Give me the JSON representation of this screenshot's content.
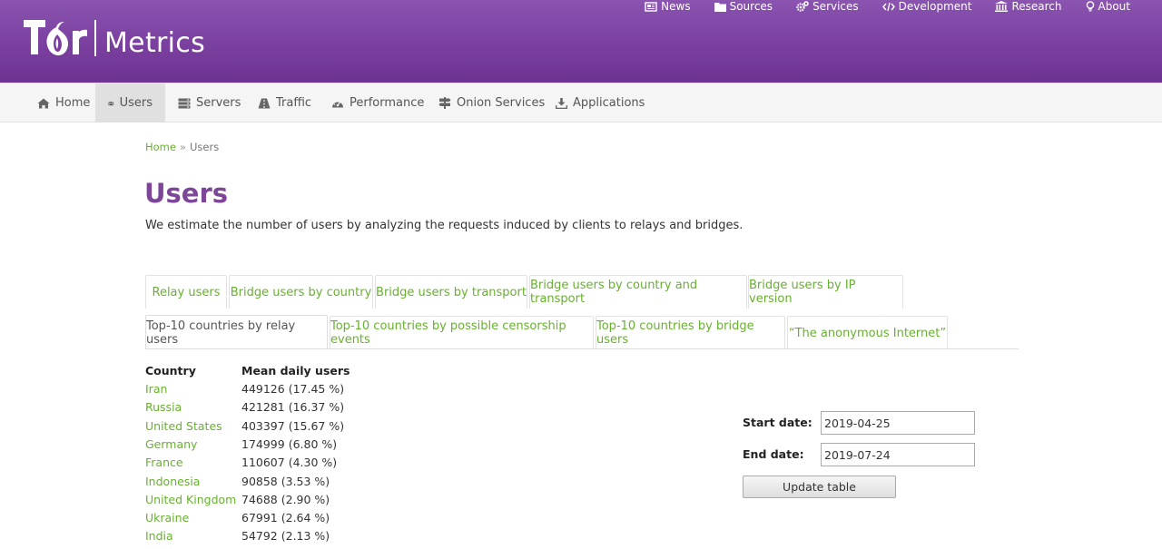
{
  "header": {
    "logo_text": "Tor",
    "product_name": "Metrics",
    "top_nav": [
      {
        "label": "News",
        "icon": "newspaper-icon"
      },
      {
        "label": "Sources",
        "icon": "folder-icon"
      },
      {
        "label": "Services",
        "icon": "cogs-icon"
      },
      {
        "label": "Development",
        "icon": "code-icon"
      },
      {
        "label": "Research",
        "icon": "institution-icon"
      },
      {
        "label": "About",
        "icon": "lightbulb-icon"
      }
    ]
  },
  "subnav": {
    "items": [
      {
        "label": "Home",
        "icon": "home-icon"
      },
      {
        "label": "Users",
        "icon": "users-icon",
        "active": true
      },
      {
        "label": "Servers",
        "icon": "server-icon"
      },
      {
        "label": "Traffic",
        "icon": "road-icon"
      },
      {
        "label": "Performance",
        "icon": "dashboard-icon"
      },
      {
        "label": "Onion Services",
        "icon": "signpost-icon"
      },
      {
        "label": "Applications",
        "icon": "download-icon"
      }
    ]
  },
  "breadcrumb": {
    "home": "Home",
    "separator": "»",
    "current": "Users"
  },
  "page": {
    "title": "Users",
    "intro": "We estimate the number of users by analyzing the requests induced by clients to relays and bridges."
  },
  "tabs": {
    "row1": [
      "Relay users",
      "Bridge users by country",
      "Bridge users by transport",
      "Bridge users by country and transport",
      "Bridge users by IP version"
    ],
    "row2": [
      "Top-10 countries by relay users",
      "Top-10 countries by possible censorship events",
      "Top-10 countries by bridge users",
      "“The anonymous Internet”"
    ],
    "active": "Top-10 countries by relay users"
  },
  "table": {
    "headers": [
      "Country",
      "Mean daily users"
    ],
    "rows": [
      {
        "country": "Iran",
        "value": "449126 (17.45 %)"
      },
      {
        "country": "Russia",
        "value": "421281 (16.37 %)"
      },
      {
        "country": "United States",
        "value": "403397 (15.67 %)"
      },
      {
        "country": "Germany",
        "value": "174999 (6.80 %)"
      },
      {
        "country": "France",
        "value": "110607 (4.30 %)"
      },
      {
        "country": "Indonesia",
        "value": "90858 (3.53 %)"
      },
      {
        "country": "United Kingdom",
        "value": "74688 (2.90 %)"
      },
      {
        "country": "Ukraine",
        "value": "67991 (2.64 %)"
      },
      {
        "country": "India",
        "value": "54792 (2.13 %)"
      }
    ]
  },
  "form": {
    "start_label": "Start date:",
    "start_value": "2019-04-25",
    "end_label": "End date:",
    "end_value": "2019-07-24",
    "button_label": "Update table"
  },
  "colors": {
    "header_purple": "#7a3f9f",
    "title_purple": "#7d4698",
    "link_green": "#68b030"
  }
}
